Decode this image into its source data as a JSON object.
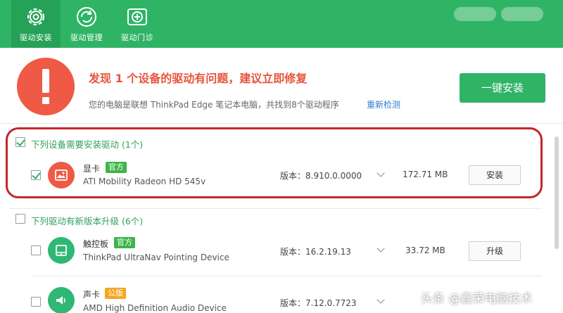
{
  "header": {
    "tabs": [
      {
        "label": "驱动安装",
        "icon": "gear-icon"
      },
      {
        "label": "驱动管理",
        "icon": "refresh-icon"
      },
      {
        "label": "驱动门诊",
        "icon": "medical-kit-icon"
      }
    ],
    "accent": "#2fb466"
  },
  "alert": {
    "title": "发现 1 个设备的驱动有问题，建议立即修复",
    "subtitle": "您的电脑是联想 ThinkPad Edge 笔记本电脑，共找到8个驱动程序",
    "recheck": "重新检测",
    "install_all": "一键安装",
    "icon": "exclamation-icon",
    "color": "#ee5a45"
  },
  "sections": [
    {
      "title": "下列设备需要安装驱动 (1个)",
      "checked": true,
      "items": [
        {
          "name": "显卡",
          "badge": "官方",
          "badge_color": "#3cb54a",
          "model": "ATI Mobility Radeon HD 545v",
          "version": "版本：8.910.0.0000",
          "size": "172.71 MB",
          "action": "安装",
          "checked": true,
          "icon": "display-card-icon",
          "icon_color": "#ee5a45"
        }
      ]
    },
    {
      "title": "下列驱动有新版本升级 (6个)",
      "checked": false,
      "items": [
        {
          "name": "触控板",
          "badge": "官方",
          "badge_color": "#3cb54a",
          "model": "ThinkPad UltraNav Pointing Device",
          "version": "版本：16.2.19.13",
          "size": "33.72 MB",
          "action": "升级",
          "checked": false,
          "icon": "touchpad-icon",
          "icon_color": "#2fb874"
        },
        {
          "name": "声卡",
          "badge": "公版",
          "badge_color": "#f5a623",
          "model": "AMD High Definition Audio Device",
          "version": "版本：7.12.0.7723",
          "size": "",
          "action": "",
          "checked": false,
          "icon": "speaker-icon",
          "icon_color": "#2fb874"
        }
      ]
    }
  ],
  "watermark": "头条 @鑫荣电脑技术"
}
